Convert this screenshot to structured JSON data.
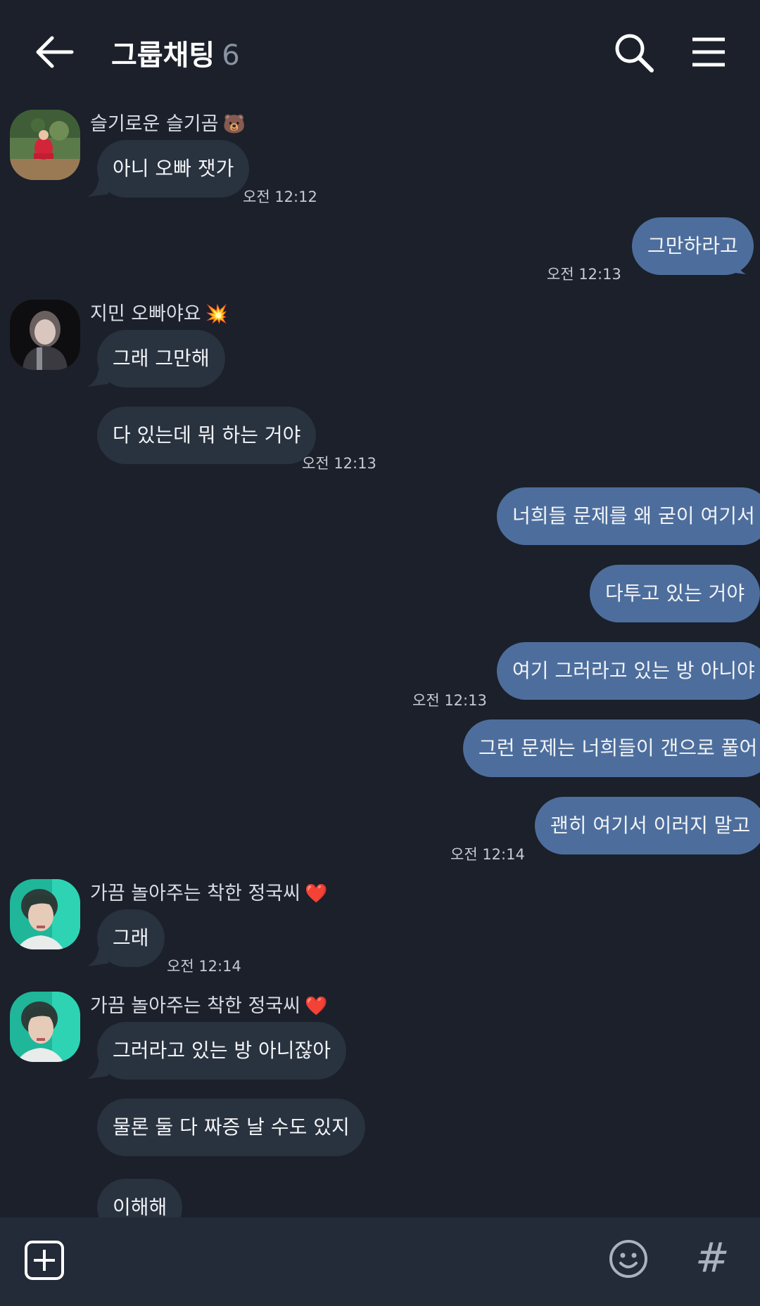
{
  "header": {
    "title": "그룹채팅",
    "member_count": "6",
    "back_icon": "arrow-left-icon",
    "search_icon": "search-icon",
    "menu_icon": "hamburger-menu-icon"
  },
  "messages": [
    {
      "sender": "슬기로운 슬기곰",
      "sender_emoji": "🐻",
      "text": "아니 오빠 잿가",
      "time": "오전 12:12"
    },
    {
      "text": "그만하라고",
      "time": "오전 12:13"
    },
    {
      "sender": "지민 오빠야요",
      "sender_emoji": "💥",
      "text": "그래 그만해"
    },
    {
      "text": "다 있는데 뭐 하는 거야",
      "time": "오전 12:13"
    },
    {
      "text": "너희들 문제를 왜 굳이 여기서"
    },
    {
      "text": "다투고 있는 거야"
    },
    {
      "text": "여기 그러라고 있는 방 아니야",
      "time": "오전 12:13"
    },
    {
      "text": "그런 문제는 너희들이 갠으로 풀어"
    },
    {
      "text": "괜히 여기서 이러지 말고",
      "time": "오전 12:14"
    },
    {
      "sender": "가끔 놀아주는 착한 정국씨",
      "sender_emoji": "❤️",
      "text": "그래",
      "time": "오전 12:14"
    },
    {
      "sender": "가끔 놀아주는 착한 정국씨",
      "sender_emoji": "❤️",
      "text": "그러라고 있는 방 아니잖아"
    },
    {
      "text": "물론 둘 다 짜증 날 수도 있지"
    },
    {
      "text": "이해해"
    }
  ],
  "bottom_bar": {
    "add_icon": "plus-square-icon",
    "emoji_icon": "smiley-icon",
    "hash_label": "#"
  },
  "colors": {
    "background": "#1b202a",
    "incoming_bubble": "#29323f",
    "outgoing_bubble": "#4d6e9d",
    "bottom_bar": "#232b39"
  }
}
